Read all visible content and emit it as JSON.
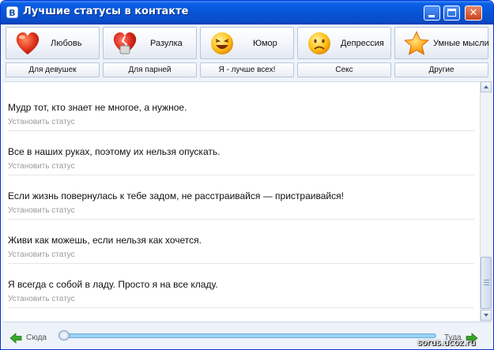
{
  "window": {
    "title": "Лучшие статусы в контакте",
    "app_icon_letter": "В"
  },
  "categories": [
    {
      "label": "Любовь",
      "icon": "heart-icon"
    },
    {
      "label": "Разулка",
      "icon": "broken-heart-icon"
    },
    {
      "label": "Юмор",
      "icon": "laughing-smiley-icon"
    },
    {
      "label": "Депрессия",
      "icon": "sad-smiley-icon"
    },
    {
      "label": "Умные мысли",
      "icon": "star-icon"
    }
  ],
  "subcategories": [
    {
      "label": "Для девушек"
    },
    {
      "label": "Для парней"
    },
    {
      "label": "Я - лучше всех!"
    },
    {
      "label": "Секс"
    },
    {
      "label": "Другие"
    }
  ],
  "statuses": [
    {
      "text": "Мудр тот, кто знает не многое, а нужное.",
      "action": "Установить статус"
    },
    {
      "text": "Все в наших руках, поэтому их нельзя опускать.",
      "action": "Установить статус"
    },
    {
      "text": "Если жизнь повернулась к тебе задом, не расстраивайся — пристраивайся!",
      "action": "Установить статус"
    },
    {
      "text": "Живи как можешь, если нельзя как хочется.",
      "action": "Установить статус"
    },
    {
      "text": "Я всегда с собой в ладу. Просто я на все кладу.",
      "action": "Установить статус"
    }
  ],
  "navigation": {
    "back_label": "Сюда",
    "forward_label": "Туда",
    "progress": 0
  },
  "watermark": "sorus.ucoz.ru",
  "colors": {
    "titlebar": "#0655d8",
    "accent_green": "#3aa52c",
    "progress": "#9ad2f3"
  }
}
